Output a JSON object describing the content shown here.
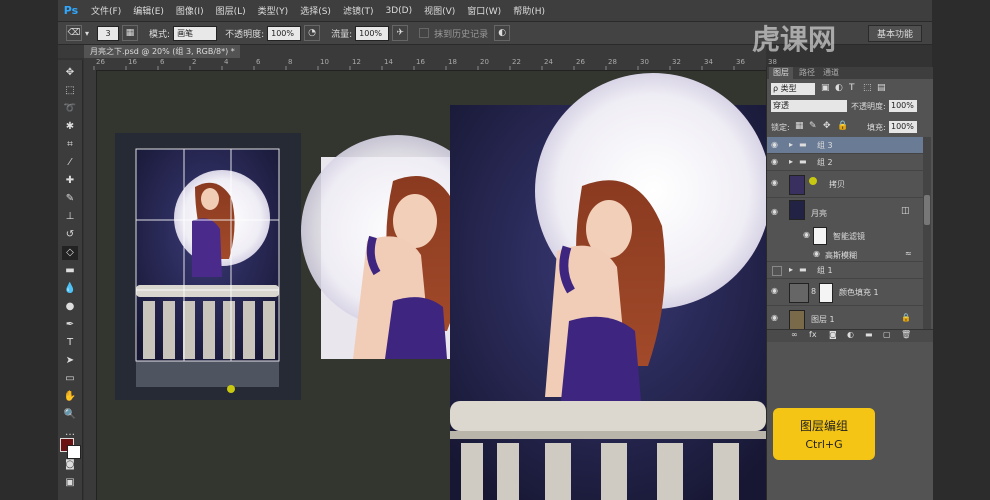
{
  "app": {
    "logo": "Ps",
    "watermark": "虎课网"
  },
  "menubar": {
    "items": [
      "文件(F)",
      "编辑(E)",
      "图像(I)",
      "图层(L)",
      "类型(Y)",
      "选择(S)",
      "滤镜(T)",
      "3D(D)",
      "视图(V)",
      "窗口(W)",
      "帮助(H)"
    ]
  },
  "options": {
    "brush_size": "3",
    "mode_label": "模式:",
    "mode_value": "画笔",
    "opacity_label": "不透明度:",
    "opacity_value": "100%",
    "flow_label": "流量:",
    "flow_value": "100%",
    "history_label": "抹到历史记录",
    "workspace": "基本功能"
  },
  "document": {
    "tab_title": "月亮之下.psd @ 20% (组 3, RGB/8*) *"
  },
  "ruler": {
    "ticks": [
      "26",
      "16",
      "6",
      "2",
      "4",
      "6",
      "8",
      "10",
      "12",
      "14",
      "16",
      "18",
      "20",
      "22",
      "24",
      "26",
      "28",
      "30",
      "32",
      "34",
      "36",
      "38"
    ]
  },
  "panel": {
    "tabs": [
      "图层",
      "路径",
      "通道"
    ],
    "filter_label": "ρ 类型",
    "blend_mode": "穿透",
    "opacity_label": "不透明度:",
    "opacity_value": "100%",
    "lock_label": "锁定:",
    "fill_label": "填充:",
    "fill_value": "100%",
    "layers": [
      {
        "name": "组 3"
      },
      {
        "name": "组 2"
      },
      {
        "name": "拷贝"
      },
      {
        "name": "月亮"
      },
      {
        "name": "智能滤镜"
      },
      {
        "name": "高斯模糊"
      },
      {
        "name": "组 1"
      },
      {
        "name": "颜色填充 1"
      },
      {
        "name": "图层 1"
      }
    ],
    "footer_icons": [
      "link-icon",
      "fx-icon",
      "mask-icon",
      "adjustment-icon",
      "folder-icon",
      "new-layer-icon",
      "trash-icon"
    ]
  },
  "badge": {
    "title": "图层编组",
    "shortcut": "Ctrl+G"
  },
  "colors": {
    "accent": "#31a8ff",
    "badge": "#f4c514",
    "selected_layer": "#6a7b96"
  }
}
